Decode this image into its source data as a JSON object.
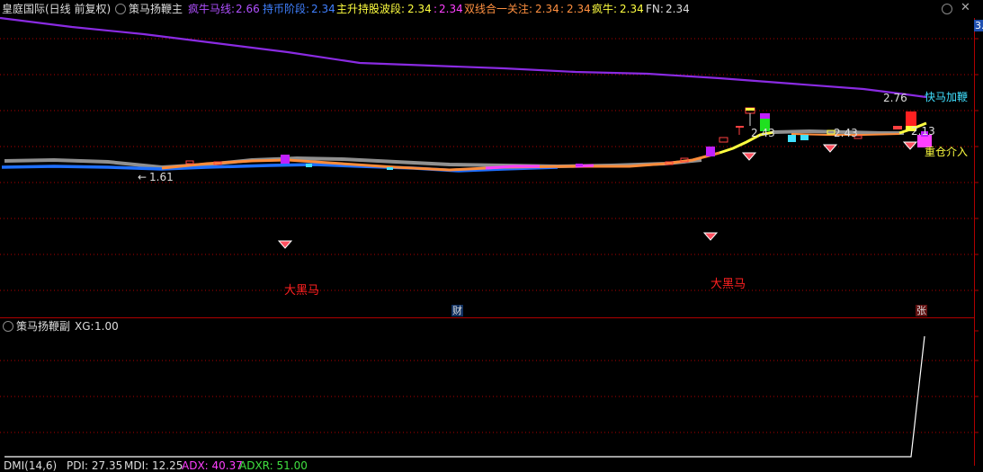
{
  "header": {
    "stock_name": "皇庭国际(日线 前复权)",
    "indicator_name": "策马扬鞭主",
    "items": [
      {
        "label": "疯牛马线:",
        "value": "2.66",
        "color": "#b050ff"
      },
      {
        "label": "持币阶段:",
        "value": "2.34",
        "color": "#4080ff"
      },
      {
        "label": "主升持股波段:",
        "value": "2.34",
        "color": "#ffff40"
      },
      {
        "label": ":",
        "value": "2.34",
        "color": "#ff40ff"
      },
      {
        "label": "双线合一关注:",
        "value": "2.34",
        "color": "#ff9040"
      },
      {
        "label": ":",
        "value": "2.34",
        "color": "#ff9040"
      },
      {
        "label": "疯牛:",
        "value": "2.34",
        "color": "#ffff40"
      },
      {
        "label": "FN:",
        "value": "2.34",
        "color": "#dddddd"
      }
    ]
  },
  "main_annotations": {
    "low_price": "1.61",
    "high_line_value": "2.76",
    "kuai_ma": "快马加鞭",
    "zhong_cang": "重仓介入",
    "price_mark_1": "2.43",
    "price_mark_2": "2.43",
    "price_mark_3": "2.13",
    "da_hei_ma_1": "大黑马",
    "da_hei_ma_2": "大黑马",
    "axis_top": "3.",
    "cai": "财",
    "zhang": "张"
  },
  "sub_panel": {
    "indicator_name": "策马扬鞭副",
    "xg_label": "XG:",
    "xg_value": "1.00"
  },
  "bottom_bar": {
    "dmi": "DMI(14,6)",
    "pdi": "PDI: 27.35",
    "mdi": "MDI: 12.25",
    "adx": "ADX: 40.37",
    "adxr": "ADXR: 51.00"
  },
  "colors": {
    "purple_line": "#8a2be2",
    "orange_line": "#ff8c3a",
    "blue_line": "#1e6fff",
    "gray_line": "#909090",
    "yellow_line": "#ffff40",
    "grid": "#b00000",
    "red_text": "#ff2020",
    "cyan_text": "#40e0ff"
  }
}
